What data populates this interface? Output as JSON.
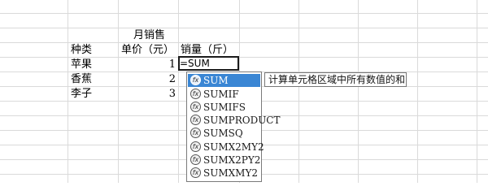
{
  "sheet": {
    "title": "月销售",
    "headers": [
      "种类",
      "单价（元）",
      "销量（斤）"
    ],
    "rows": [
      {
        "kind": "苹果",
        "price": "1"
      },
      {
        "kind": "香蕉",
        "price": "2"
      },
      {
        "kind": "李子",
        "price": "3"
      }
    ]
  },
  "formula_input": "=SUM",
  "autocomplete": {
    "items": [
      "SUM",
      "SUMIF",
      "SUMIFS",
      "SUMPRODUCT",
      "SUMSQ",
      "SUMX2MY2",
      "SUMX2PY2",
      "SUMXMY2"
    ],
    "selected_index": 0,
    "tooltip": "计算单元格区域中所有数值的和",
    "function_icon": "function-icon"
  },
  "colors": {
    "gridline": "#dadada",
    "selection": "#3a86d4"
  }
}
